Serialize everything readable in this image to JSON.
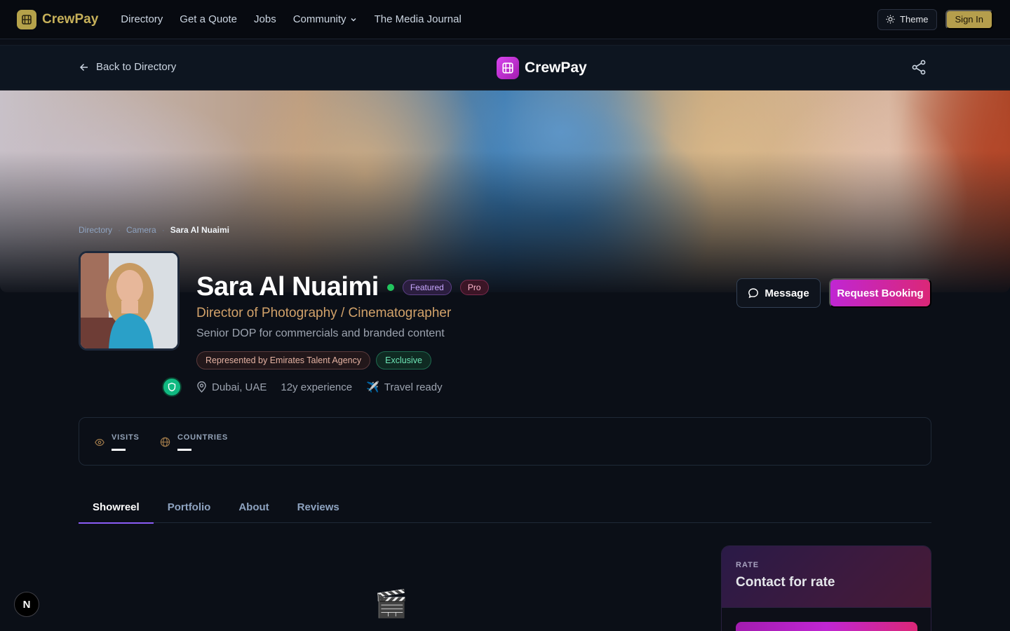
{
  "topnav": {
    "brand": "CrewPay",
    "links": [
      {
        "label": "Directory"
      },
      {
        "label": "Get a Quote"
      },
      {
        "label": "Jobs"
      },
      {
        "label": "Community"
      },
      {
        "label": "The Media Journal"
      }
    ],
    "theme_label": "Theme",
    "signin_label": "Sign In"
  },
  "subbar": {
    "back_label": "Back to Directory",
    "brand": "CrewPay"
  },
  "breadcrumb": {
    "items": [
      "Directory",
      "Camera"
    ],
    "current": "Sara Al Nuaimi"
  },
  "profile": {
    "name": "Sara Al Nuaimi",
    "online": true,
    "badges": {
      "featured": "Featured",
      "pro": "Pro"
    },
    "role": "Director of Photography / Cinematographer",
    "tagline": "Senior DOP for commercials and branded content",
    "agency": "Represented by Emirates Talent Agency",
    "exclusive": "Exclusive",
    "location": "Dubai, UAE",
    "experience": "12y experience",
    "travel": "Travel ready"
  },
  "actions": {
    "message": "Message",
    "booking": "Request Booking"
  },
  "stats": {
    "visits_label": "VISITS",
    "countries_label": "COUNTRIES"
  },
  "tabs": [
    {
      "label": "Showreel"
    },
    {
      "label": "Portfolio"
    },
    {
      "label": "About"
    },
    {
      "label": "Reviews"
    }
  ],
  "showreel": {
    "icon": "🎬"
  },
  "rate": {
    "label": "RATE",
    "value": "Contact for rate"
  },
  "dev_badge": "N",
  "colors": {
    "accent_gold": "#c7b15a",
    "accent_magenta": "#c026d3",
    "online": "#22c55e",
    "verified": "#10b981",
    "tab_underline": "#8b5cf6"
  }
}
